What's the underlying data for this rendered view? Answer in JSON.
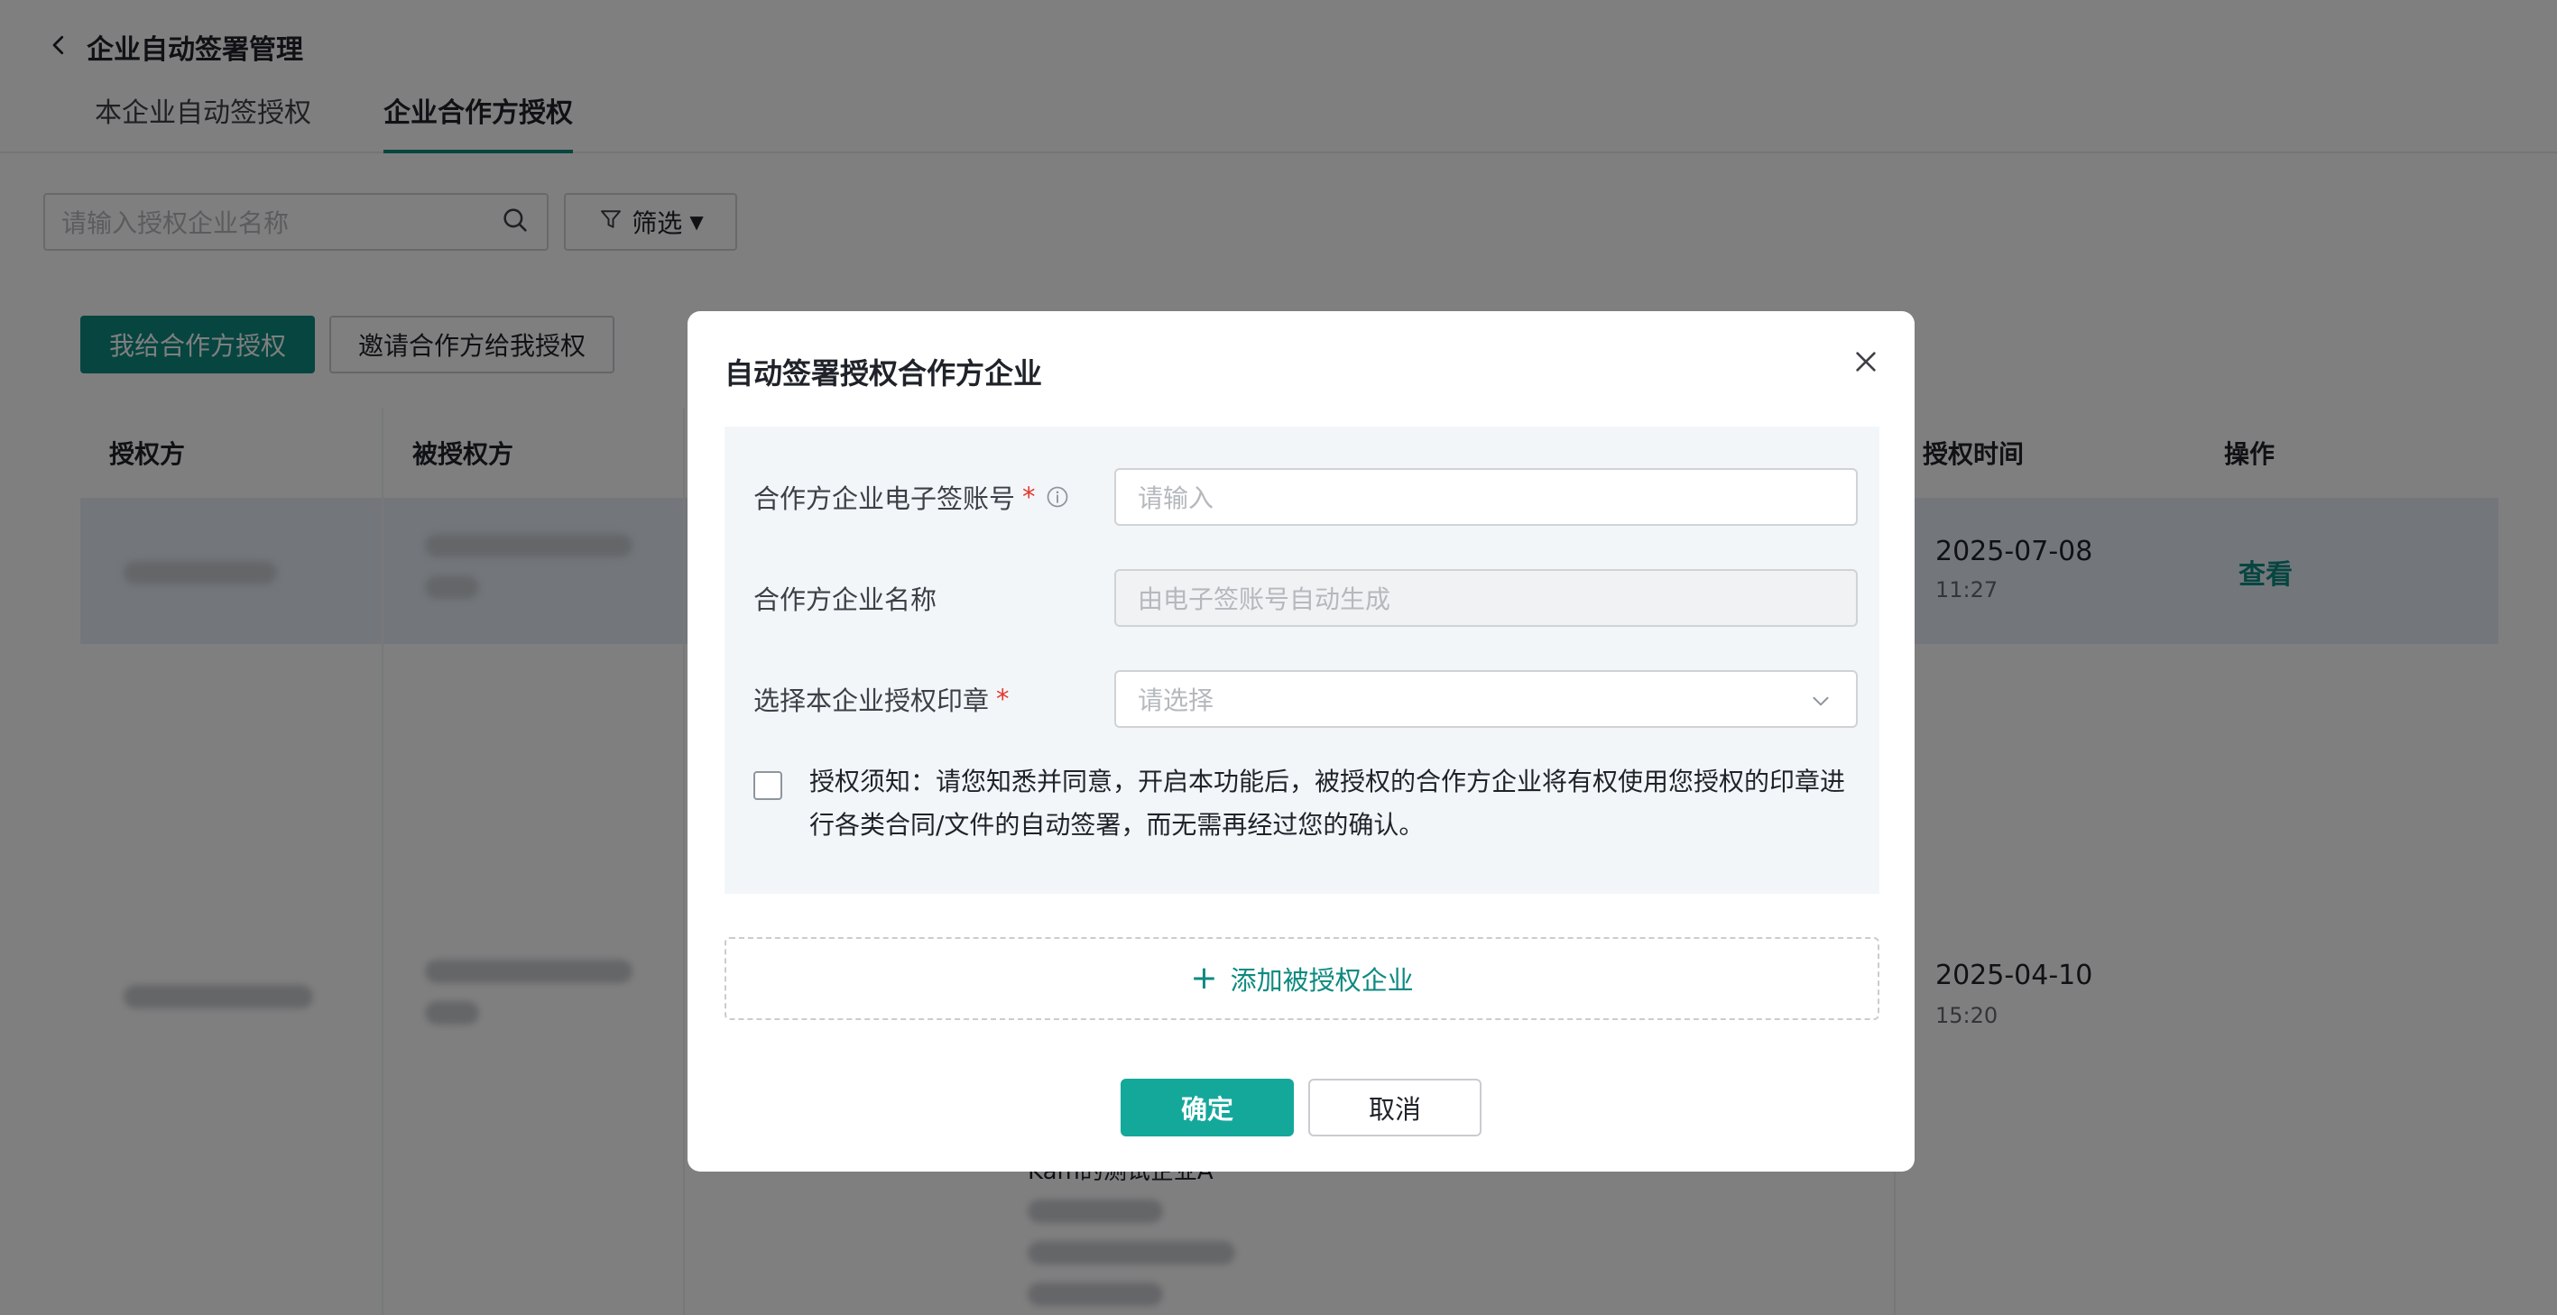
{
  "header": {
    "title": "企业自动签署管理",
    "tabs": [
      {
        "label": "本企业自动签授权"
      },
      {
        "label": "企业合作方授权"
      }
    ]
  },
  "toolbar": {
    "search_placeholder": "请输入授权企业名称",
    "filter_label": "筛选"
  },
  "actions": {
    "grant_label": "我给合作方授权",
    "invite_label": "邀请合作方给我授权"
  },
  "table": {
    "columns": [
      "授权方",
      "被授权方",
      "授权时间",
      "操作"
    ],
    "rows": [
      {
        "date": "2025-07-08",
        "time": "11:27",
        "action": "查看"
      },
      {
        "date": "2025-04-10",
        "time": "15:20"
      }
    ],
    "partial_text": "Kam的测试企业A"
  },
  "modal": {
    "title": "自动签署授权合作方企业",
    "fields": {
      "account_label": "合作方企业电子签账号",
      "account_placeholder": "请输入",
      "name_label": "合作方企业名称",
      "name_placeholder": "由电子签账号自动生成",
      "seal_label": "选择本企业授权印章",
      "seal_placeholder": "请选择",
      "required_mark": "*"
    },
    "notice": "授权须知：请您知悉并同意，开启本功能后，被授权的合作方企业将有权使用您授权的印章进行各类合同/文件的自动签署，而无需再经过您的确认。",
    "add_label": "添加被授权企业",
    "confirm_label": "确定",
    "cancel_label": "取消"
  },
  "colors": {
    "accent": "#14a89b",
    "accent_dark": "#0e8a80",
    "required": "#e4382d"
  }
}
